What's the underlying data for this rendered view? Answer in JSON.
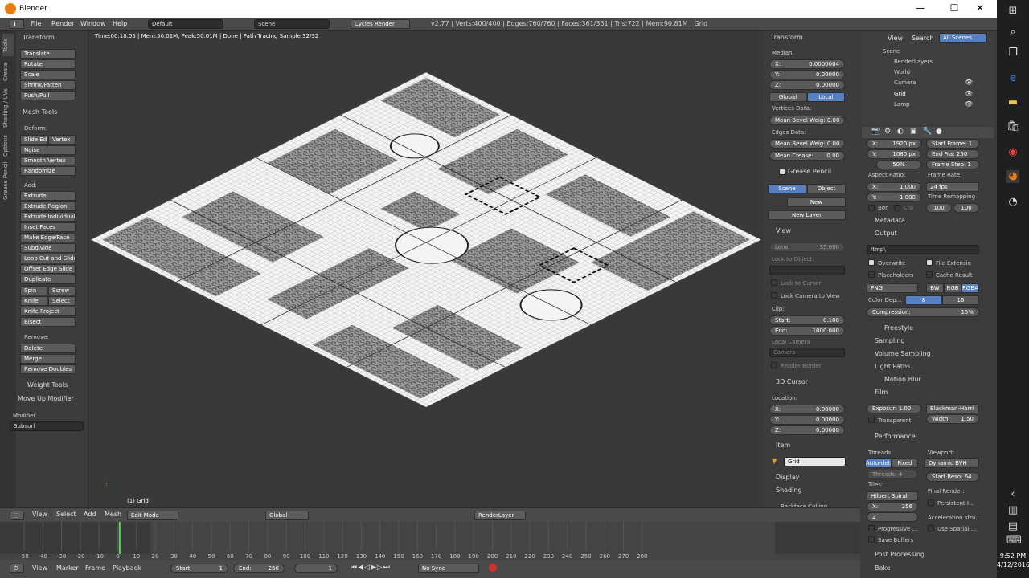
{
  "window": {
    "title": "Blender",
    "minimize": "—",
    "maximize": "☐",
    "close": "✕"
  },
  "menubar": {
    "file": "File",
    "render": "Render",
    "window": "Window",
    "help": "Help",
    "layout": "Default",
    "scene": "Scene",
    "engine": "Cycles Render",
    "stats": "v2.77 | Verts:400/400 | Edges:760/760 | Faces:361/361 | Tris:722 | Mem:90.81M | Grid"
  },
  "viewport": {
    "status": "Time:00:18.05 | Mem:50.01M, Peak:50.01M | Done | Path Tracing Sample 32/32",
    "object_label": "(1) Grid"
  },
  "tools": {
    "tabs": [
      "Tools",
      "Create",
      "Shading / UVs",
      "Options",
      "Grease Pencil"
    ],
    "transform_header": "Transform",
    "transform": [
      "Translate",
      "Rotate",
      "Scale",
      "Shrink/Fatten",
      "Push/Pull"
    ],
    "mesh_header": "Mesh Tools",
    "deform_label": "Deform:",
    "slide_edge": "Slide Ed",
    "vertex": "Vertex",
    "noise": "Noise",
    "smooth_vertex": "Smooth Vertex",
    "randomize": "Randomize",
    "add_label": "Add:",
    "extrude": "Extrude",
    "add": [
      "Extrude Region",
      "Extrude Individual",
      "Inset Faces",
      "Make Edge/Face",
      "Subdivide",
      "Loop Cut and Slide",
      "Offset Edge Slide",
      "Duplicate"
    ],
    "spin": "Spin",
    "screw": "Screw",
    "knife": "Knife",
    "select": "Select",
    "knife_project": "Knife Project",
    "bisect": "Bisect",
    "remove_label": "Remove:",
    "delete": "Delete",
    "merge": "Merge",
    "remove_doubles": "Remove Doubles",
    "weight_header": "Weight Tools",
    "modifier_header": "Move Up Modifier",
    "modifier_label": "Modifier",
    "modifier_value": "Subsurf"
  },
  "npanel": {
    "transform_header": "Transform",
    "median": "Median:",
    "x": "X:",
    "x_val": "0.0000004",
    "y": "Y:",
    "y_val": "0.00000",
    "z": "Z:",
    "z_val": "0.00000",
    "global": "Global",
    "local": "Local",
    "vertices_data": "Vertices Data:",
    "mean_bevel_v": "Mean Bevel Weig: 0.00",
    "edges_data": "Edges Data:",
    "mean_bevel_e": "Mean Bevel Weig: 0.00",
    "mean_crease": "Mean Crease:",
    "mean_crease_val": "0.00",
    "grease_header": "Grease Pencil",
    "scene": "Scene",
    "object": "Object",
    "new": "New",
    "new_layer": "New Layer",
    "view_header": "View",
    "lens": "Lens:",
    "lens_val": "35.000",
    "lock_obj": "Lock to Object:",
    "lock_cursor": "Lock to Cursor",
    "lock_camera": "Lock Camera to View",
    "clip": "Clip:",
    "start": "Start:",
    "start_val": "0.100",
    "end": "End:",
    "end_val": "1000.000",
    "local_camera": "Local Camera",
    "camera": "Camera",
    "render_border": "Render Border",
    "cursor_header": "3D Cursor",
    "location": "Location:",
    "cx": "0.00000",
    "cy": "0.00000",
    "cz": "0.00000",
    "item_header": "Item",
    "item_name": "Grid",
    "display_header": "Display",
    "shading_header": "Shading",
    "backface": "Backface Culling"
  },
  "outliner": {
    "view": "View",
    "search": "Search",
    "all_scenes": "All Scenes",
    "items": [
      "Scene",
      "RenderLayers",
      "World",
      "Camera",
      "Grid",
      "Lamp"
    ]
  },
  "props": {
    "res_x": "X:",
    "res_x_val": "1920 px",
    "res_y": "Y:",
    "res_y_val": "1080 px",
    "res_pct": "50%",
    "start_frame": "Start Frame: 1",
    "end_frame": "End Fra: 250",
    "frame_step": "Frame Step: 1",
    "aspect": "Aspect Ratio:",
    "frame_rate": "Frame Rate:",
    "ax": "X:",
    "ax_val": "1.000",
    "ay": "Y:",
    "ay_val": "1.000",
    "fps": "24 fps",
    "time_remap": "Time Remapping",
    "bor": "Bor",
    "cro": "Cro",
    "remap_a": "100",
    "remap_b": "100",
    "metadata": "Metadata",
    "output": "Output",
    "path": "/tmp\\",
    "overwrite": "Overwrite",
    "file_ext": "File Extensio",
    "placeholders": "Placeholders",
    "cache_result": "Cache Result",
    "format": "PNG",
    "bw": "BW",
    "rgb": "RGB",
    "rgba": "RGBA",
    "color_depth": "Color Dep...",
    "depth8": "8",
    "depth16": "16",
    "compression": "Compression:",
    "compression_val": "15%",
    "freestyle": "Freestyle",
    "sampling": "Sampling",
    "volume_sampling": "Volume Sampling",
    "light_paths": "Light Paths",
    "motion_blur": "Motion Blur",
    "film": "Film",
    "exposure": "Exposur: 1.00",
    "filter": "Blackman-Harri",
    "transparent": "Transparent",
    "width": "Width:",
    "width_val": "1.50",
    "performance": "Performance",
    "threads": "Threads:",
    "viewport": "Viewport:",
    "autodetect": "Auto-dete",
    "fixed": "Fixed",
    "dynamic_bvh": "Dynamic BVH",
    "threads_count": "Threads: 4",
    "start_reso": "Start Reso: 64",
    "tiles": "Tiles:",
    "final_render": "Final Render:",
    "hilbert": "Hilbert Spiral",
    "persistent": "Persistent I...",
    "tile_x": "X:",
    "tile_x_val": "256",
    "tile_y_val": "2",
    "accel": "Acceleration stru...",
    "progressive": "Progressive ...",
    "use_spatial": "Use Spatial ...",
    "save_buffers": "Save Buffers",
    "post_processing": "Post Processing",
    "bake": "Bake"
  },
  "view_header": {
    "view": "View",
    "select": "Select",
    "add": "Add",
    "mesh": "Mesh",
    "mode": "Edit Mode",
    "orientation": "Global",
    "render_layer": "RenderLayer"
  },
  "timeline": {
    "ticks": [
      "-50",
      "-40",
      "-30",
      "-20",
      "-10",
      "0",
      "10",
      "20",
      "30",
      "40",
      "50",
      "60",
      "70",
      "80",
      "90",
      "100",
      "110",
      "120",
      "130",
      "140",
      "150",
      "160",
      "170",
      "180",
      "190",
      "200",
      "210",
      "220",
      "230",
      "240",
      "250",
      "260",
      "270",
      "280"
    ],
    "current": 1
  },
  "timeline_header": {
    "view": "View",
    "marker": "Marker",
    "frame": "Frame",
    "playback": "Playback",
    "start": "Start:",
    "start_val": "1",
    "end": "End:",
    "end_val": "250",
    "current": "1",
    "sync": "No Sync"
  },
  "taskbar": {
    "time": "9:52 PM",
    "date": "4/12/2016"
  }
}
